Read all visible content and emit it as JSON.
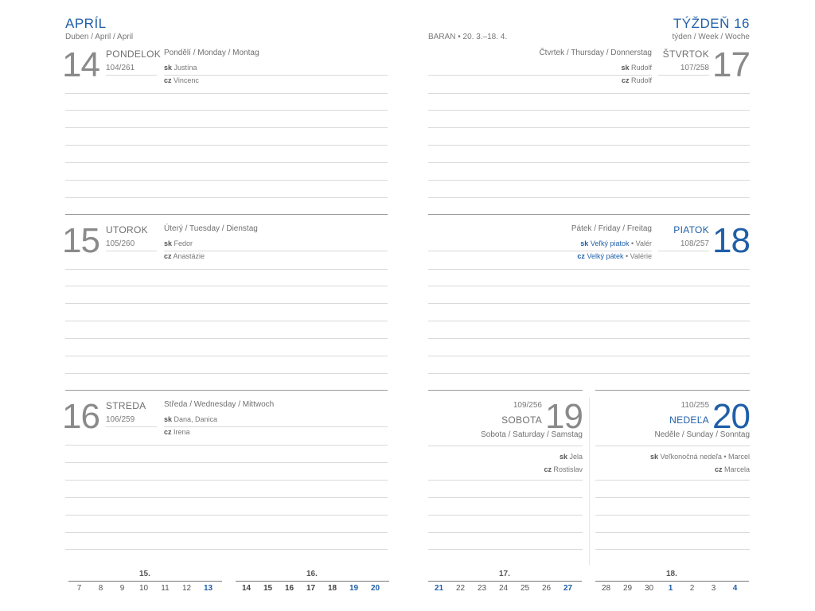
{
  "header": {
    "month_title": "APRÍL",
    "month_subtitle": "Duben / April / April",
    "zodiac": "BARAN • 20. 3.–18. 4.",
    "week_title": "TÝŽDEŇ 16",
    "week_subtitle": "týden / Week / Woche"
  },
  "days": {
    "d14": {
      "number": "14",
      "name": "PONDELOK",
      "count": "104/261",
      "translations": "Pondělí / Monday / Montag",
      "sk_label": "sk",
      "sk": "Justína",
      "cz_label": "cz",
      "cz": "Vincenc"
    },
    "d15": {
      "number": "15",
      "name": "UTOROK",
      "count": "105/260",
      "translations": "Úterý / Tuesday / Dienstag",
      "sk_label": "sk",
      "sk": "Fedor",
      "cz_label": "cz",
      "cz": "Anastázie"
    },
    "d16": {
      "number": "16",
      "name": "STREDA",
      "count": "106/259",
      "translations": "Středa / Wednesday / Mittwoch",
      "sk_label": "sk",
      "sk": "Dana, Danica",
      "cz_label": "cz",
      "cz": "Irena"
    },
    "d17": {
      "number": "17",
      "name": "ŠTVRTOK",
      "count": "107/258",
      "translations": "Čtvrtek / Thursday / Donnerstag",
      "sk_label": "sk",
      "sk": "Rudolf",
      "cz_label": "cz",
      "cz": "Rudolf"
    },
    "d18": {
      "number": "18",
      "name": "PIATOK",
      "count": "108/257",
      "translations": "Pátek / Friday / Freitag",
      "sk_label": "sk",
      "sk_holiday": "Veľký piatok",
      "sk": "• Valér",
      "cz_label": "cz",
      "cz_holiday": "Velký pátek",
      "cz": "• Valérie"
    },
    "d19": {
      "number": "19",
      "name": "SOBOTA",
      "count": "109/256",
      "translations": "Sobota / Saturday / Samstag",
      "sk_label": "sk",
      "sk": "Jela",
      "cz_label": "cz",
      "cz": "Rostislav"
    },
    "d20": {
      "number": "20",
      "name": "NEDEĽA",
      "count": "110/255",
      "translations": "Neděle / Sunday / Sonntag",
      "sk_label": "sk",
      "sk": "Veľkonočná nedeľa • Marcel",
      "cz_label": "cz",
      "cz": "Marcela"
    }
  },
  "mini_calendar": {
    "weeks": [
      "15.",
      "16.",
      "17.",
      "18."
    ],
    "week15": [
      "7",
      "8",
      "9",
      "10",
      "11",
      "12",
      "13"
    ],
    "week16": [
      "14",
      "15",
      "16",
      "17",
      "18",
      "19",
      "20"
    ],
    "week17": [
      "21",
      "22",
      "23",
      "24",
      "25",
      "26",
      "27"
    ],
    "week18": [
      "28",
      "29",
      "30",
      "1",
      "2",
      "3",
      "4"
    ]
  },
  "colors": {
    "accent": "#1f5fa8",
    "text": "#6f6f6f",
    "rule": "#d9d9d9"
  }
}
